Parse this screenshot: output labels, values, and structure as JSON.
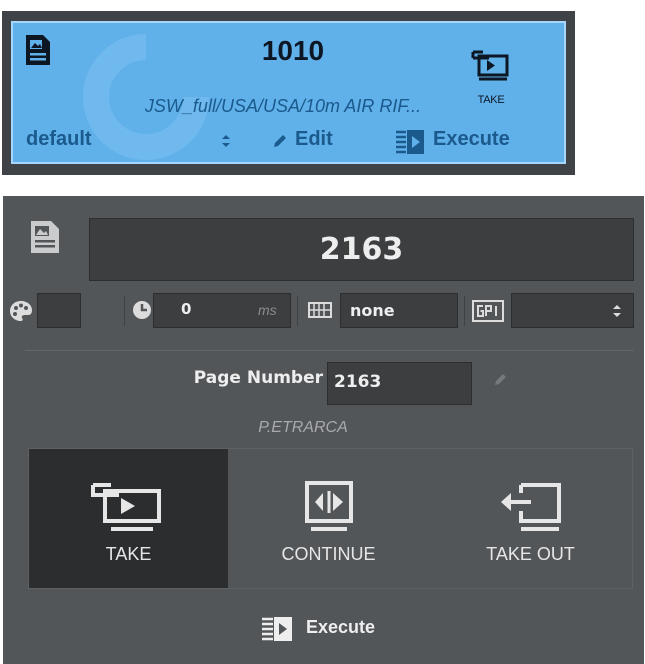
{
  "compact_card": {
    "number": "1010",
    "path": "JSW_full/USA/USA/10m AIR RIF...",
    "take_label": "TAKE",
    "concept_value": "default",
    "edit_label": "Edit",
    "execute_label": "Execute",
    "colors": {
      "background": "#60b0ea",
      "border": "#a6d6fb",
      "text": "#1b5a8d"
    },
    "icons": [
      "document-icon",
      "take-icon",
      "updown-arrows-icon",
      "pencil-icon",
      "execute-icon"
    ]
  },
  "expanded_panel": {
    "number": "2163",
    "delay_value": "0",
    "delay_unit": "ms",
    "layer_value": "none",
    "page_number_label": "Page Number",
    "page_number_value": "2163",
    "template_name": "P.ETRARCA",
    "actions": [
      {
        "label": "TAKE",
        "icon": "take-icon",
        "selected": true
      },
      {
        "label": "CONTINUE",
        "icon": "continue-icon",
        "selected": false
      },
      {
        "label": "TAKE OUT",
        "icon": "take-out-icon",
        "selected": false
      }
    ],
    "execute_label": "Execute",
    "colors": {
      "background": "#535659",
      "field": "#3c3e40",
      "selected_action": "#2b2d2f"
    },
    "icons": [
      "document-icon",
      "palette-icon",
      "clock-icon",
      "grid-icon",
      "gpi-icon",
      "pencil-icon",
      "execute-icon"
    ]
  }
}
